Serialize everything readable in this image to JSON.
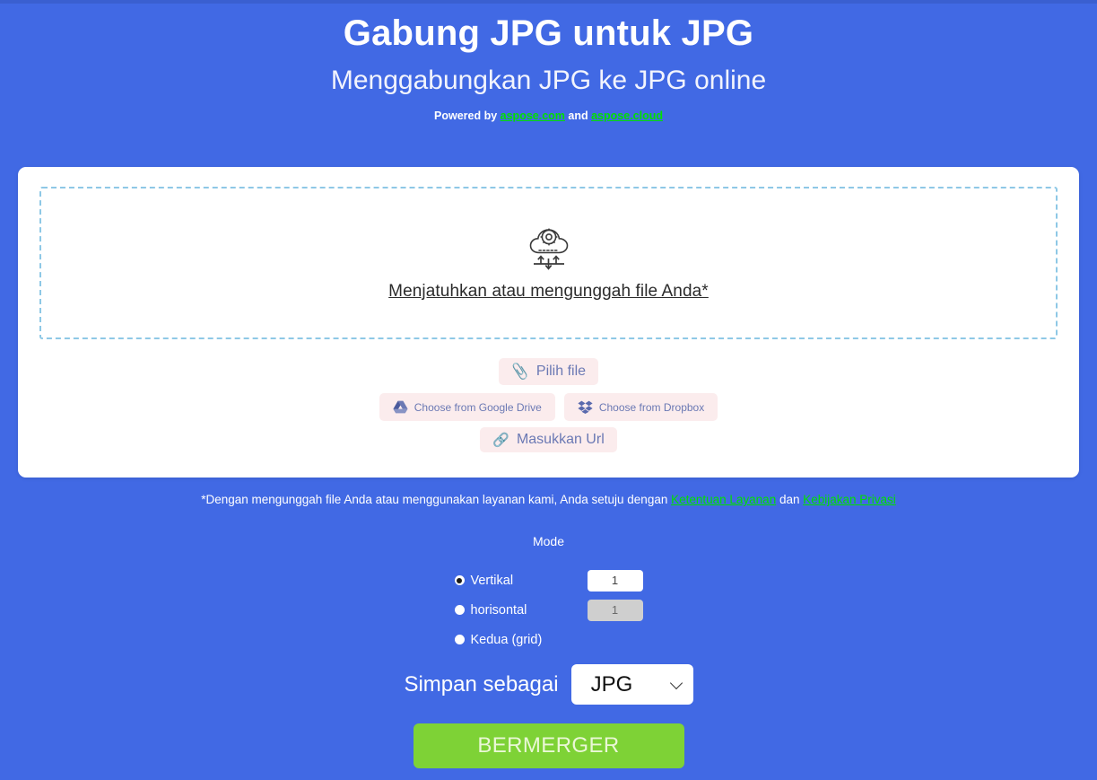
{
  "header": {
    "title": "Gabung JPG untuk JPG",
    "subtitle": "Menggabungkan JPG ke JPG online",
    "powered_prefix": "Powered by ",
    "powered_link1": "aspose.com",
    "powered_middle": " and ",
    "powered_link2": "aspose.cloud"
  },
  "dropzone": {
    "icon": "cloud-upload-gear-icon",
    "text": "Menjatuhkan atau mengunggah file Anda*"
  },
  "buttons": {
    "choose_file": "Pilih file",
    "google_drive": "Choose from Google Drive",
    "dropbox": "Choose from Dropbox",
    "enter_url": "Masukkan Url"
  },
  "terms": {
    "prefix": "*Dengan mengunggah file Anda atau menggunakan layanan kami, Anda setuju dengan ",
    "link1": "Ketentuan Layanan",
    "middle": " dan ",
    "link2": "Kebijakan Privasi"
  },
  "mode": {
    "label": "Mode",
    "options": [
      {
        "label": "Vertikal",
        "checked": true,
        "value": "1",
        "disabled": false,
        "has_input": true
      },
      {
        "label": "horisontal",
        "checked": false,
        "value": "1",
        "disabled": true,
        "has_input": true
      },
      {
        "label": "Kedua (grid)",
        "checked": false,
        "value": "",
        "disabled": false,
        "has_input": false
      }
    ]
  },
  "save_as": {
    "label": "Simpan sebagai",
    "selected": "JPG",
    "options": [
      "JPG"
    ]
  },
  "cta": {
    "label": "BERMERGER"
  },
  "colors": {
    "background": "#4169e4",
    "card": "#ffffff",
    "link_green": "#00e000",
    "button_soft_bg": "#fbeced",
    "button_soft_text": "#6b79b4",
    "dashed_border": "#8ec8e6",
    "cta_green": "#7ed236"
  }
}
